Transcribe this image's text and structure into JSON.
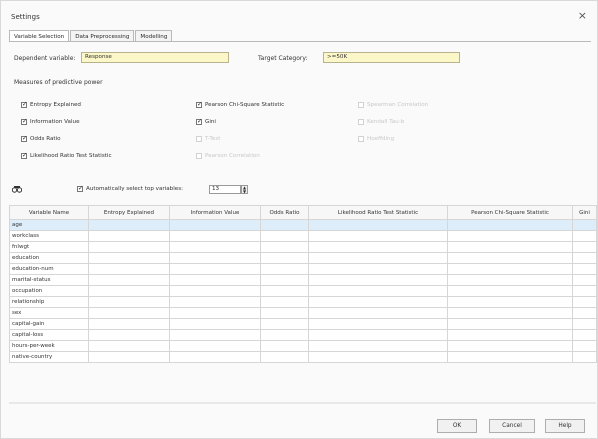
{
  "window": {
    "title": "Settings",
    "close_glyph": "×"
  },
  "tabs": [
    {
      "label": "Variable Selection"
    },
    {
      "label": "Data Preprocessing"
    },
    {
      "label": "Modelling"
    }
  ],
  "form": {
    "dependent_label": "Dependent variable:",
    "dependent_value": "Response",
    "target_label": "Target Category:",
    "target_value": ">=50K"
  },
  "measures": {
    "title": "Measures of predictive power",
    "col1": [
      {
        "label": "Entropy Explained",
        "checked": true
      },
      {
        "label": "Information Value",
        "checked": true
      },
      {
        "label": "Odds Ratio",
        "checked": true
      },
      {
        "label": "Likelihood Ratio Test Statistic",
        "checked": true
      }
    ],
    "col2": [
      {
        "label": "Pearson Chi-Square Statistic",
        "checked": true
      },
      {
        "label": "Gini",
        "checked": true
      },
      {
        "label": "T-Test",
        "checked": false,
        "disabled": true
      },
      {
        "label": "Pearson Correlation",
        "checked": false,
        "disabled": true
      }
    ],
    "col3": [
      {
        "label": "Spearman Correlation",
        "checked": false,
        "disabled": true
      },
      {
        "label": "Kendall Tau-b",
        "checked": false,
        "disabled": true
      },
      {
        "label": "Hoeffding",
        "checked": false,
        "disabled": true
      }
    ]
  },
  "toolbar": {
    "icon": "binoculars-icon",
    "auto_select_label": "Automatically select top variables:",
    "auto_select_checked": true,
    "top_n": "13"
  },
  "table": {
    "headers": [
      "Variable Name",
      "Entropy Explained",
      "Information Value",
      "Odds Ratio",
      "Likelihood Ratio Test Statistic",
      "Pearson Chi-Square Statistic",
      "Gini"
    ],
    "rows": [
      "age",
      "workclass",
      "fnlwgt",
      "education",
      "education-num",
      "marital-status",
      "occupation",
      "relationship",
      "sex",
      "capital-gain",
      "capital-loss",
      "hours-per-week",
      "native-country"
    ]
  },
  "buttons": {
    "ok": "OK",
    "cancel": "Cancel",
    "help": "Help"
  }
}
